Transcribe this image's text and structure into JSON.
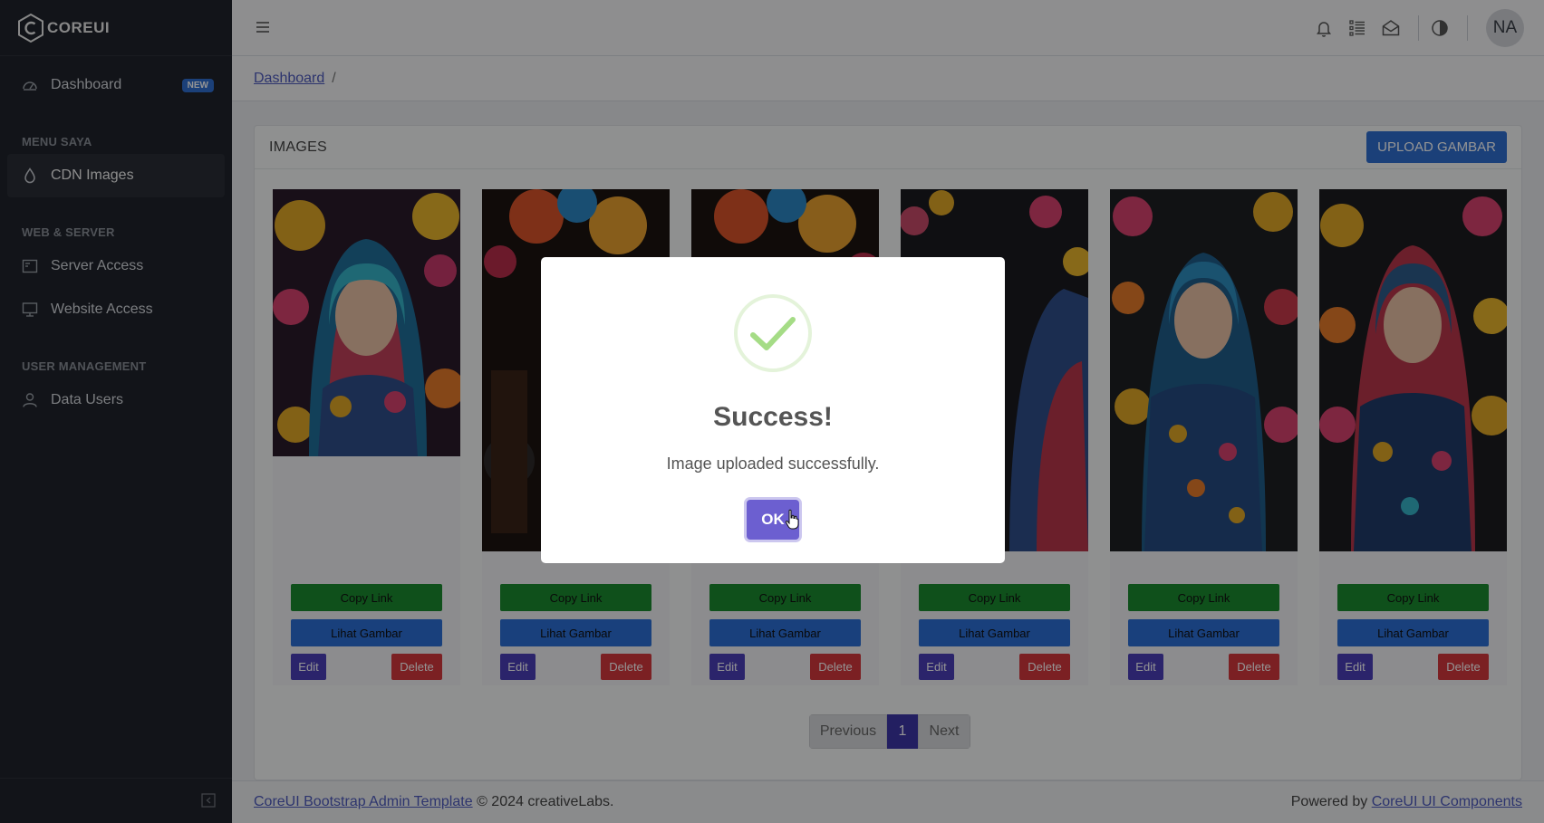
{
  "brand": {
    "name": "COREUI"
  },
  "sidebar": {
    "dashboard": {
      "label": "Dashboard",
      "badge": "NEW"
    },
    "sections": [
      {
        "title": "MENU SAYA",
        "items": [
          {
            "label": "CDN Images",
            "icon": "drop-icon",
            "active": true
          }
        ]
      },
      {
        "title": "WEB & SERVER",
        "items": [
          {
            "label": "Server Access",
            "icon": "server-icon"
          },
          {
            "label": "Website Access",
            "icon": "monitor-icon"
          }
        ]
      },
      {
        "title": "USER MANAGEMENT",
        "items": [
          {
            "label": "Data Users",
            "icon": "user-icon"
          }
        ]
      }
    ]
  },
  "header": {
    "avatar_initials": "NA",
    "icons": [
      "bell-icon",
      "list-icon",
      "envelope-icon",
      "contrast-icon"
    ]
  },
  "breadcrumb": {
    "root": "Dashboard",
    "separator": "/"
  },
  "card": {
    "title": "IMAGES",
    "upload_label": "UPLOAD GAMBAR",
    "tiles": [
      {
        "copy": "Copy Link",
        "view": "Lihat Gambar",
        "edit": "Edit",
        "delete": "Delete"
      },
      {
        "copy": "Copy Link",
        "view": "Lihat Gambar",
        "edit": "Edit",
        "delete": "Delete"
      },
      {
        "copy": "Copy Link",
        "view": "Lihat Gambar",
        "edit": "Edit",
        "delete": "Delete"
      },
      {
        "copy": "Copy Link",
        "view": "Lihat Gambar",
        "edit": "Edit",
        "delete": "Delete"
      },
      {
        "copy": "Copy Link",
        "view": "Lihat Gambar",
        "edit": "Edit",
        "delete": "Delete"
      },
      {
        "copy": "Copy Link",
        "view": "Lihat Gambar",
        "edit": "Edit",
        "delete": "Delete"
      }
    ],
    "pagination": {
      "previous": "Previous",
      "current": "1",
      "next": "Next"
    }
  },
  "footer": {
    "left_link": "CoreUI Bootstrap Admin Template",
    "left_text": "© 2024 creativeLabs.",
    "right_text": "Powered by",
    "right_link": "CoreUI UI Components"
  },
  "modal": {
    "title": "Success!",
    "message": "Image uploaded successfully.",
    "ok_label": "OK"
  },
  "colors": {
    "sidebar_bg": "#1f232b",
    "primary": "#2f6fd1",
    "copy_green": "#1a8a2f",
    "delete_red": "#d4373d",
    "edit_purple": "#4a3fb8",
    "ok_button": "#6c5fd0",
    "success_green": "#a5dc86"
  }
}
